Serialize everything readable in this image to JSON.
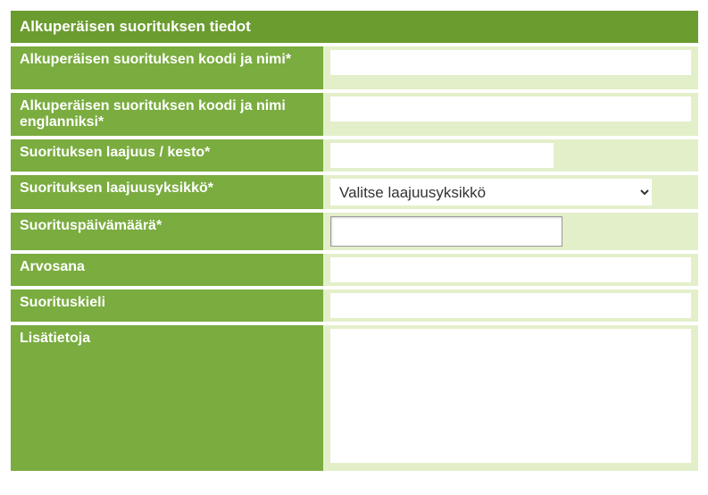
{
  "form": {
    "header": "Alkuperäisen suorituksen tiedot",
    "fields": {
      "code_name": {
        "label": "Alkuperäisen suorituksen koodi ja nimi*",
        "value": ""
      },
      "code_name_en": {
        "label": "Alkuperäisen suorituksen koodi ja nimi englanniksi*",
        "value": ""
      },
      "scope_duration": {
        "label": "Suorituksen laajuus / kesto*",
        "value": ""
      },
      "scope_unit": {
        "label": "Suorituksen laajuusyksikkö*",
        "placeholder": "Valitse laajuusyksikkö",
        "value": ""
      },
      "completion_date": {
        "label": "Suorituspäivämäärä*",
        "value": ""
      },
      "grade": {
        "label": "Arvosana",
        "value": ""
      },
      "language": {
        "label": "Suorituskieli",
        "value": ""
      },
      "additional_info": {
        "label": "Lisätietoja",
        "value": ""
      }
    }
  }
}
